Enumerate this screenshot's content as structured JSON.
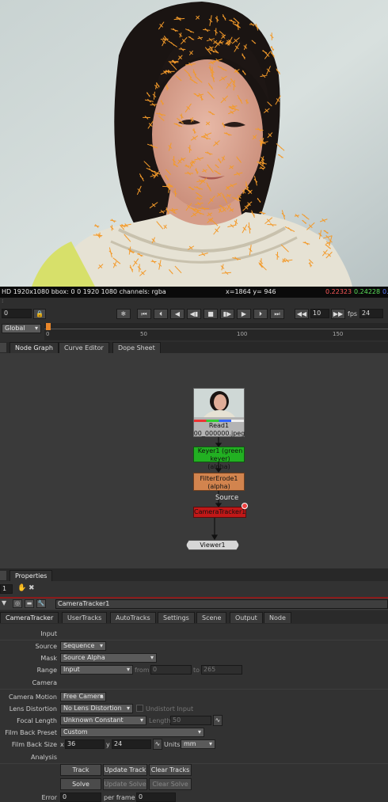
{
  "viewer": {
    "info_text": "HD 1920x1080 bbox: 0 0 1920 1080 channels: rgba",
    "coords_text": "x=1864 y= 946",
    "r_value": "0.22323",
    "g_value": "0.24228",
    "b_value": "0.",
    "colors": {
      "r": "#ff5a5a",
      "g": "#5ae05a",
      "b": "#5a7aff",
      "track_marker": "#f39a2a"
    }
  },
  "timeline": {
    "frame_value": "0",
    "scope": "Global",
    "step_value": "10",
    "fps_label": "fps",
    "fps_value": "24",
    "ticks": [
      "0",
      "50",
      "100",
      "150"
    ]
  },
  "node_graph": {
    "tabs": [
      "Node Graph",
      "Curve Editor",
      "Dope Sheet"
    ],
    "nodes": {
      "read_label": "Read1",
      "read_file": "00_000000.jpeg",
      "keyer_label": "Keyer1 (green keyer)",
      "keyer_sub": "(alpha)",
      "erode_label": "FilterErode1",
      "erode_sub": "(alpha)",
      "source_label": "Source",
      "tracker_label": "CameraTracker1",
      "viewer_label": "Viewer1"
    }
  },
  "properties": {
    "tab_label": "Properties",
    "count": "1",
    "node_name": "CameraTracker1",
    "tabs": [
      "CameraTracker",
      "UserTracks",
      "AutoTracks",
      "Settings",
      "Scene",
      "Output",
      "Node"
    ],
    "sections": {
      "input": "Input",
      "camera": "Camera",
      "analysis": "Analysis"
    },
    "fields": {
      "source_label": "Source",
      "source_value": "Sequence",
      "mask_label": "Mask",
      "mask_value": "Source Alpha",
      "range_label": "Range",
      "range_value": "Input",
      "from_label": "from",
      "from_value": "0",
      "to_label": "to",
      "to_value": "265",
      "camera_motion_label": "Camera Motion",
      "camera_motion_value": "Free Camera",
      "lens_distortion_label": "Lens Distortion",
      "lens_distortion_value": "No Lens Distortion",
      "undistort_label": "Undistort Input",
      "focal_length_label": "Focal Length",
      "focal_length_value": "Unknown Constant",
      "length_label": "Length",
      "length_value": "50",
      "film_back_preset_label": "Film Back Preset",
      "film_back_preset_value": "Custom",
      "film_back_size_label": "Film Back Size",
      "x_label": "x",
      "x_value": "36",
      "y_label": "y",
      "y_value": "24",
      "units_label": "Units",
      "units_value": "mm",
      "error_label": "Error",
      "error_value": "0",
      "per_frame_label": "per frame",
      "per_frame_value": "0"
    },
    "buttons": {
      "track": "Track",
      "update_track": "Update Track",
      "clear_tracks": "Clear Tracks",
      "solve": "Solve",
      "update_solve": "Update Solve",
      "clear_solve": "Clear Solve"
    }
  }
}
